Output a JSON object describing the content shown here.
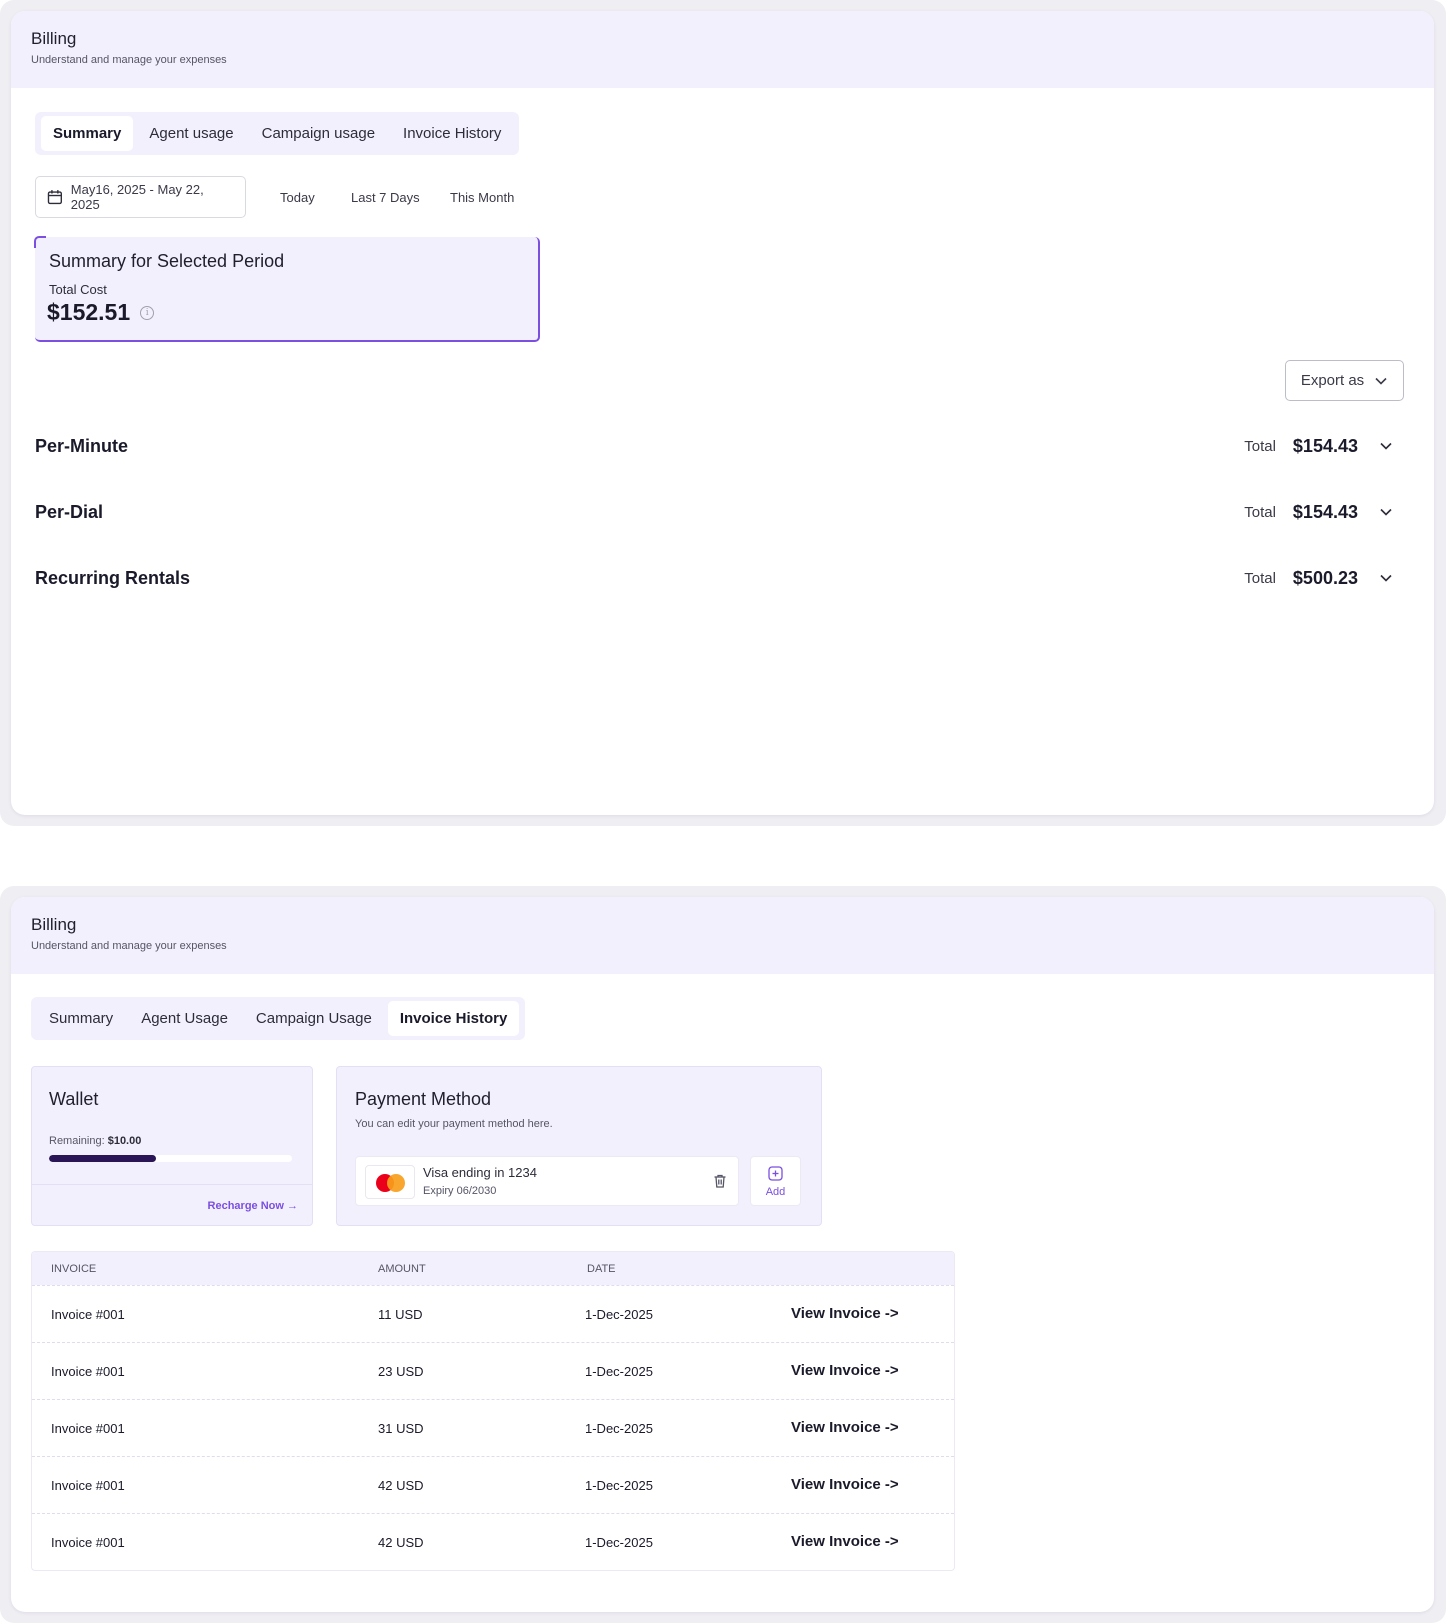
{
  "summary_view": {
    "header": {
      "title": "Billing",
      "subtitle": "Understand and manage your expenses"
    },
    "tabs": [
      "Summary",
      "Agent usage",
      "Campaign usage",
      "Invoice History"
    ],
    "active_tab": "Summary",
    "date_range": "May16, 2025 - May 22, 2025",
    "quick_ranges": [
      "Today",
      "Last 7 Days",
      "This Month"
    ],
    "summary_card": {
      "title": "Summary for Selected Period",
      "label": "Total Cost",
      "amount": "$152.51"
    },
    "export_label": "Export as",
    "cost_rows": [
      {
        "name": "Per-Minute",
        "total_label": "Total",
        "total": "$154.43"
      },
      {
        "name": "Per-Dial",
        "total_label": "Total",
        "total": "$154.43"
      },
      {
        "name": "Recurring Rentals",
        "total_label": "Total",
        "total": "$500.23"
      }
    ]
  },
  "invoice_view": {
    "header": {
      "title": "Billing",
      "subtitle": "Understand and manage your expenses"
    },
    "tabs": [
      "Summary",
      "Agent Usage",
      "Campaign Usage",
      "Invoice History"
    ],
    "active_tab": "Invoice History",
    "wallet": {
      "title": "Wallet",
      "remaining_label": "Remaining:",
      "remaining_value": "$10.00",
      "progress_fraction": 0.44,
      "recharge_label": "Recharge Now →"
    },
    "payment": {
      "title": "Payment Method",
      "subtitle": "You can edit your payment method here.",
      "card_name": "Visa ending in 1234",
      "card_expiry": "Expiry 06/2030",
      "add_label": "Add"
    },
    "table": {
      "columns": [
        "INVOICE",
        "AMOUNT",
        "DATE"
      ],
      "rows": [
        {
          "invoice": "Invoice #001",
          "amount": "11 USD",
          "date": "1-Dec-2025",
          "action": "View Invoice ->"
        },
        {
          "invoice": "Invoice #001",
          "amount": "23 USD",
          "date": "1-Dec-2025",
          "action": "View Invoice ->"
        },
        {
          "invoice": "Invoice #001",
          "amount": "31 USD",
          "date": "1-Dec-2025",
          "action": "View Invoice ->"
        },
        {
          "invoice": "Invoice #001",
          "amount": "42 USD",
          "date": "1-Dec-2025",
          "action": "View Invoice ->"
        },
        {
          "invoice": "Invoice #001",
          "amount": "42 USD",
          "date": "1-Dec-2025",
          "action": "View Invoice ->"
        }
      ]
    }
  },
  "colors": {
    "accent": "#7b4fe0",
    "header_bg": "#f3f0fd",
    "progress": "#2a1556"
  },
  "icons": [
    "calendar-icon",
    "info-icon",
    "chevron-down-icon",
    "trash-icon",
    "add-square-icon",
    "mastercard-logo"
  ]
}
